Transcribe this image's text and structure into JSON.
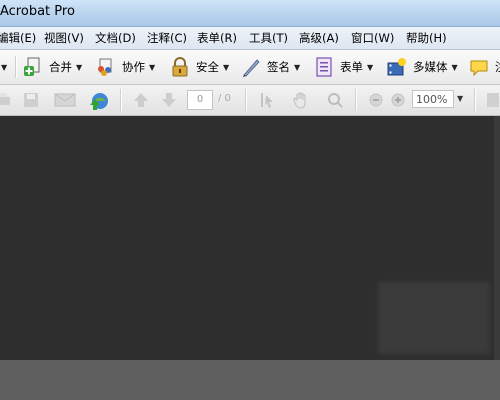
{
  "window": {
    "title": "Acrobat Pro"
  },
  "menubar": {
    "items": [
      {
        "label": "编辑(E)"
      },
      {
        "label": "视图(V)"
      },
      {
        "label": "文档(D)"
      },
      {
        "label": "注释(C)"
      },
      {
        "label": "表单(R)"
      },
      {
        "label": "工具(T)"
      },
      {
        "label": "高级(A)"
      },
      {
        "label": "窗口(W)"
      },
      {
        "label": "帮助(H)"
      }
    ]
  },
  "task_toolbar": {
    "buttons": [
      {
        "label": "合并",
        "icon": "combine-icon"
      },
      {
        "label": "协作",
        "icon": "collaborate-icon"
      },
      {
        "label": "安全",
        "icon": "lock-icon"
      },
      {
        "label": "签名",
        "icon": "pen-icon"
      },
      {
        "label": "表单",
        "icon": "form-icon"
      },
      {
        "label": "多媒体",
        "icon": "multimedia-icon"
      },
      {
        "label": "注",
        "icon": "comment-icon"
      }
    ]
  },
  "nav_toolbar": {
    "page_input": "0",
    "page_total": "/ 0",
    "zoom": "100%"
  },
  "colors": {
    "titlebar": "#b8d3ee",
    "document_bg": "#2e2e2e",
    "workspace_bg": "#5e5e5e"
  }
}
